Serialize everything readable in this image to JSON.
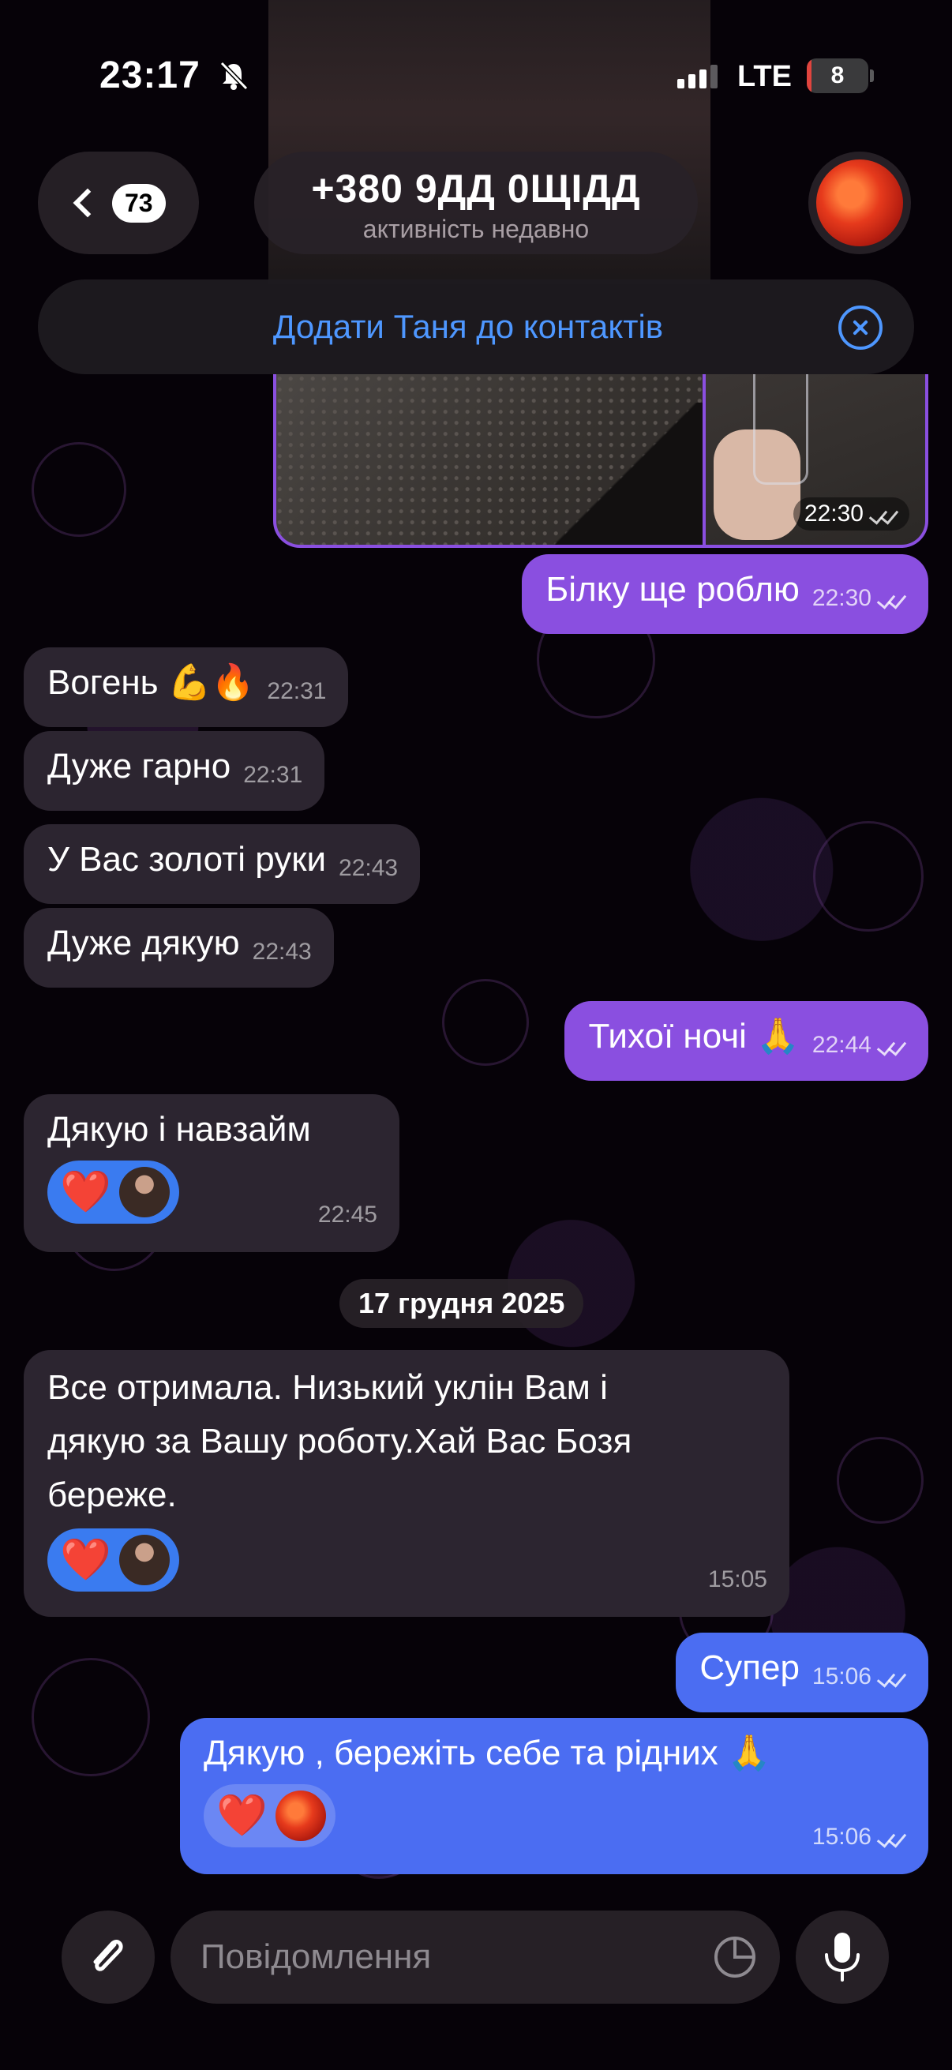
{
  "status_bar": {
    "time": "23:17",
    "network": "LTE",
    "battery": "8",
    "battery_level_percent": 8
  },
  "header": {
    "back_count": "73",
    "title": "+380 9ДД 0ЩІДД",
    "subtitle": "активність недавно",
    "avatar_icon": "autumn-leaf-avatar"
  },
  "banner": {
    "label": "Додати Таня до контактів"
  },
  "photo_message": {
    "time": "22:30"
  },
  "messages": [
    {
      "text": "Білку ще роблю",
      "time": "22:30",
      "direction": "out"
    },
    {
      "text": "Вогень 💪🔥",
      "time": "22:31",
      "direction": "in"
    },
    {
      "text": "Дуже гарно",
      "time": "22:31",
      "direction": "in"
    },
    {
      "text": "У Вас золоті руки",
      "time": "22:43",
      "direction": "in"
    },
    {
      "text": "Дуже дякую",
      "time": "22:43",
      "direction": "in"
    },
    {
      "text": "Тихої ночі 🙏",
      "time": "22:44",
      "direction": "out"
    },
    {
      "text": "Дякую і навзайм",
      "time": "22:45",
      "direction": "in",
      "reaction": "❤️"
    },
    {
      "text_lines": [
        "Все отримала.  Низький уклін Вам і",
        "дякую за Вашу роботу.Хай Вас Бозя",
        "береже."
      ],
      "time": "15:05",
      "direction": "in",
      "reaction": "❤️"
    },
    {
      "text": "Супер",
      "time": "15:06",
      "direction": "out"
    },
    {
      "text": "Дякую , бережіть себе та рідних 🙏",
      "time": "15:06",
      "direction": "out",
      "reaction": "❤️"
    }
  ],
  "date_separator": "17 грудня 2025",
  "input": {
    "placeholder": "Повідомлення",
    "value": ""
  },
  "colors": {
    "outgoing_bubble": "#8a4fe0",
    "outgoing_bubble_alt": "#4b6df2",
    "incoming_bubble": "#2c2530",
    "accent": "#4e97ff",
    "heart": "#e8102a"
  }
}
